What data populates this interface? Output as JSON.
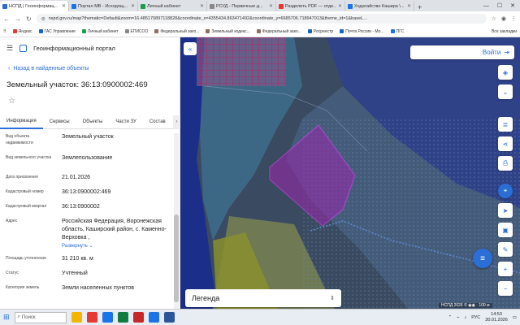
{
  "browser": {
    "tabs": [
      {
        "label": "НСПД | Геоинформац...",
        "color": "#2b6ed6",
        "active": true
      },
      {
        "label": "Портал МВ - Исходящ...",
        "color": "#1a73e8",
        "active": false
      },
      {
        "label": "Личный кабинет",
        "color": "#1a9e4b",
        "active": false
      },
      {
        "label": "РСУД - Первичные д...",
        "color": "#888888",
        "active": false
      },
      {
        "label": "Разделить PDF — отде...",
        "color": "#e53935",
        "active": false
      },
      {
        "label": "Ходатайство Кашира \\...",
        "color": "#1a73e8",
        "active": false
      }
    ],
    "new_tab": "+",
    "url": "nspd.gov.ru/map?thematic=Default&zoom=16.485170897118828&coordinate_x=4355434.863471492&coordinate_y=6685706.718947013&theme_id=1&baseL...",
    "bookmarks": [
      {
        "label": "Яндекс",
        "color": "#e53935"
      },
      {
        "label": "ГАС Управление",
        "color": "#1565c0"
      },
      {
        "label": "Личный кабинет",
        "color": "#1a9e4b"
      },
      {
        "label": "ЕПИСОО",
        "color": "#888888"
      },
      {
        "label": "Федеральный зако...",
        "color": "#8d6e63"
      },
      {
        "label": "Земельный кодекс...",
        "color": "#8d6e63"
      },
      {
        "label": "Федеральный зако...",
        "color": "#8d6e63"
      },
      {
        "label": "Росреестр",
        "color": "#1565c0"
      },
      {
        "label": "Почта России - Мо...",
        "color": "#1565c0"
      },
      {
        "label": "ПГС",
        "color": "#1a73e8"
      }
    ],
    "all_bookmarks": "Все закладки"
  },
  "portal": {
    "title": "Геоинформационный портал",
    "back_link": "Назад в найденные объекты",
    "object_title": "Земельный участок: 36:13:0900002:469",
    "tabs": [
      "Информация",
      "Сервисы",
      "Объекты",
      "Части ЗУ",
      "Состав"
    ],
    "attributes": [
      {
        "key": "Вид объекта недвижимости",
        "value": "Земельный участок"
      },
      {
        "key": "Вид земельного участка",
        "value": "Землепользование"
      },
      {
        "key": "Дата присвоения",
        "value": "21.01.2026"
      },
      {
        "key": "Кадастровый номер",
        "value": "36:13:0900002:469"
      },
      {
        "key": "Кадастровый квартал",
        "value": "36:13:0900002"
      },
      {
        "key": "Адрес",
        "value": "Российская Федерация, Воронежская область, Каширский район, с. Каменно-Верховка ,"
      },
      {
        "key": "Площадь уточненная",
        "value": "31 210 кв. м"
      },
      {
        "key": "Статус",
        "value": "Учтенный"
      },
      {
        "key": "Категория земель",
        "value": "Земли населенных пунктов"
      }
    ],
    "expand_label": "Развернуть"
  },
  "map": {
    "login_label": "Войти",
    "legend_label": "Легенда",
    "attribution": "НСПД 2026 © ◉◉ · 100 м"
  },
  "taskbar": {
    "search_placeholder": "Поиск",
    "language": "РУС",
    "time": "14:53",
    "date": "30.01.2026"
  }
}
